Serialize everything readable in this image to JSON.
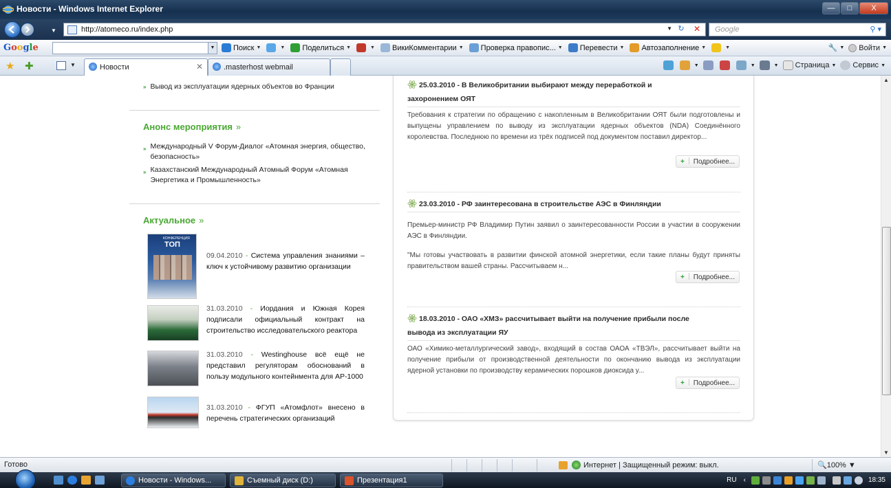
{
  "window": {
    "title": "Новости - Windows Internet Explorer",
    "controls": [
      "—",
      "□",
      "X"
    ]
  },
  "address": {
    "url": "http://atomeco.ru/index.php",
    "search_placeholder": "Google"
  },
  "google_toolbar": {
    "logo": [
      "G",
      "o",
      "o",
      "g",
      "l",
      "e"
    ],
    "items": [
      {
        "label": "Поиск",
        "icon": "search-icon",
        "color": "#2a7bd6"
      },
      {
        "label": "",
        "icon": "plus-icon",
        "color": "#5aa7e8"
      },
      {
        "label": "Поделиться",
        "icon": "share-icon",
        "color": "#2f9e35"
      },
      {
        "label": "",
        "icon": "bookmark-icon",
        "color": "#c0392b"
      },
      {
        "label": "ВикиКомментарии",
        "icon": "comment-icon",
        "color": "#9ab7d8"
      },
      {
        "label": "Проверка правопис...",
        "icon": "spellcheck-icon",
        "color": "#6aa0d6"
      },
      {
        "label": "Перевести",
        "icon": "translate-icon",
        "color": "#3d7cc9"
      },
      {
        "label": "Автозаполнение",
        "icon": "autofill-icon",
        "color": "#e39b2b"
      },
      {
        "label": "",
        "icon": "highlight-icon",
        "color": "#f0c419"
      }
    ],
    "signin": "Войти"
  },
  "tabs": [
    {
      "label": "Новости",
      "active": true
    },
    {
      "label": ".masterhost webmail",
      "active": false
    }
  ],
  "command_bar": {
    "page": "Страница",
    "tools": "Сервис"
  },
  "left": {
    "top_link": "Вывод из эксплуатации ядерных объектов во Франции",
    "announce": {
      "heading": "Анонс мероприятия",
      "items": [
        "Международный V Форум-Диалог «Атомная энергия, общество, безопасность»",
        "Казахстанский Международный Атомный Форум «Атомная Энергетика и Промышленность»"
      ]
    },
    "actual": {
      "heading": "Актуальное",
      "cover": {
        "label": "КОНФЕРЕНЦИЯ",
        "title": "ТОП"
      },
      "items": [
        {
          "date": "09.04.2010",
          "text": "Система управления знаниями – ключ к устойчивому развитию организации"
        },
        {
          "date": "31.03.2010",
          "text": "Иордания и Южная Корея подписали официальный контракт на строительство исследовательского реактора"
        },
        {
          "date": "31.03.2010",
          "text": "Westinghouse всё ещё не представил регуляторам обоснований в пользу модульного контейнмента для AP-1000"
        },
        {
          "date": "31.03.2010",
          "text": "ФГУП «Атомфлот» внесено в перечень стратегических организаций"
        }
      ]
    }
  },
  "news": [
    {
      "title_line1": "25.03.2010 - В Великобритании выбирают между переработкой и",
      "title_line2": "захоронением ОЯТ",
      "body": "Требования к стратегии по обращению с накопленным в Великобритании ОЯТ были подготовлены и выпущены управлением по выводу из эксплуатации ядерных объектов (NDA) Соединённого королевства. Последнюю по времени из трёх подписей под документом поставил директор...",
      "more": "Подробнее..."
    },
    {
      "title_line1": "23.03.2010 - РФ заинтересована в строительстве АЭС в Финляндии",
      "title_line2": "",
      "body": "Премьер-министр РФ Владимир Путин заявил о заинтересованности России в участии в сооружении АЭС в Финляндии.",
      "body2": "\"Мы готовы участвовать в развитии финской атомной энергетики, если такие планы будут приняты правительством вашей страны. Рассчитываем н...",
      "more": "Подробнее..."
    },
    {
      "title_line1": "18.03.2010 - ОАО «ХМЗ» рассчитывает выйти на получение прибыли после",
      "title_line2": "вывода из эксплуатации ЯУ",
      "body": "ОАО «Химико-металлургический завод», входящий в состав ОАОА «ТВЭЛ», рассчитывает выйти на получение прибыли от производственной деятельности по окончанию вывода из эксплуатации ядерной установки по производству керамических порошков диоксида у...",
      "more": "Подробнее..."
    }
  ],
  "status": {
    "ready": "Готово",
    "zone": "Интернет | Защищенный режим: выкл.",
    "zoom": "100%"
  },
  "taskbar": {
    "buttons": [
      {
        "label": "Новости - Windows...",
        "color": "#2c7fe0"
      },
      {
        "label": "Съемный диск (D:)",
        "color": "#e0b43a"
      },
      {
        "label": "Презентация1",
        "color": "#d9532b"
      }
    ],
    "lang": "RU",
    "time": "18:35"
  }
}
